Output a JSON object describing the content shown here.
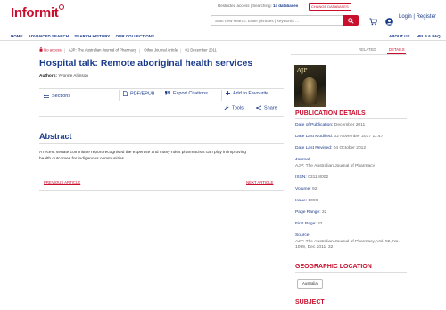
{
  "header": {
    "logo": "Informit",
    "restricted_text": "Restricted access | Searching:",
    "databases": "14 databases",
    "change_db": "CHANGE DATABASES",
    "search_placeholder": "Start new search. Enter phrases | keywords ...",
    "login": "Login",
    "register": "Register",
    "login_sep": "|"
  },
  "nav": {
    "left": [
      "HOME",
      "ADVANCED SEARCH",
      "SEARCH HISTORY",
      "OUR COLLECTIONS"
    ],
    "right": [
      "ABOUT US",
      "HELP & FAQ"
    ]
  },
  "breadcrumb": {
    "access": "No access",
    "journal": "AJP: The Australian Journal of Pharmacy",
    "type": "Other Journal Article",
    "date": "01 December 2011"
  },
  "side_tabs": {
    "related": "RELATED",
    "details": "DETAILS"
  },
  "article": {
    "title": "Hospital talk: Remote aboriginal health services",
    "authors_label": "Authors:",
    "authors": "Yvonne Allinson"
  },
  "actions": {
    "sections": "Sections",
    "pdf": "PDF/EPUB",
    "citations": "Export Citations",
    "favourite": "Add to Favourite",
    "tools": "Tools",
    "share": "Share"
  },
  "abstract": {
    "heading": "Abstract",
    "text": "A recent senate committee report recognised the expertise and many roles pharmacists can play in improving health outcomes for indigenous communities."
  },
  "pager": {
    "prev": "PREVIOUS ARTICLE",
    "next": "NEXT ARTICLE"
  },
  "cover": {
    "title": "AJP"
  },
  "publication": {
    "heading": "PUBLICATION DETAILS",
    "date_label": "Date of Publication:",
    "date": "December 2011",
    "modified_label": "Date Last Modified:",
    "modified": "02 November 2017 11:47",
    "revised_label": "Date Last Revised:",
    "revised": "04 October 2012",
    "journal_label": "Journal:",
    "journal": "AJP: The Australian Journal of Pharmacy",
    "issn_label": "ISSN:",
    "issn": "0311-8002",
    "volume_label": "Volume:",
    "volume": "92",
    "issue_label": "Issue:",
    "issue": "1099",
    "range_label": "Page Range:",
    "range": "32",
    "first_label": "First Page:",
    "first": "32",
    "source_label": "Source:",
    "source": "AJP: The Australian Journal of Pharmacy, Vol. 92, No. 1099, Dec 2011: 32"
  },
  "geographic": {
    "heading": "GEOGRAPHIC LOCATION",
    "chip": "Australia"
  },
  "subject": {
    "heading": "SUBJECT"
  },
  "colors": {
    "brand_red": "#c8102e",
    "link_blue": "#1a3a8a"
  }
}
